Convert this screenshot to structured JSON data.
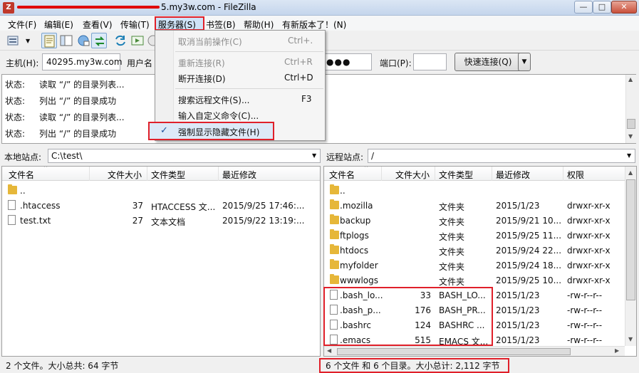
{
  "window": {
    "title": "5.my3w.com - FileZilla",
    "min": "—",
    "max": "□",
    "close": "✕"
  },
  "menubar": [
    "文件(F)",
    "编辑(E)",
    "查看(V)",
    "传输(T)",
    "服务器(S)",
    "书签(B)",
    "帮助(H)",
    "有新版本了！(N)"
  ],
  "quickconnect": {
    "host_label": "主机(H):",
    "host_value": "40295.my3w.com",
    "user_label": "用户名",
    "pass_value": "●●●",
    "port_label": "端口(P):",
    "port_value": "",
    "connect_button": "快速连接(Q)"
  },
  "server_menu": {
    "cancel": "取消当前操作(C)",
    "cancel_sc": "Ctrl+.",
    "reconnect": "重新连接(R)",
    "reconnect_sc": "Ctrl+R",
    "disconnect": "断开连接(D)",
    "disconnect_sc": "Ctrl+D",
    "search": "搜索远程文件(S)...",
    "search_sc": "F3",
    "custom_cmd": "输入自定义命令(C)...",
    "check": "✓",
    "force_hidden": "强制显示隐藏文件(H)"
  },
  "log": [
    {
      "k": "状态:",
      "v": "读取 “/” 的目录列表..."
    },
    {
      "k": "状态:",
      "v": "列出 “/” 的目录成功"
    },
    {
      "k": "状态:",
      "v": "读取 “/” 的目录列表..."
    },
    {
      "k": "状态:",
      "v": "列出 “/” 的目录成功"
    }
  ],
  "local": {
    "site_label": "本地站点:",
    "path": "C:\\test\\",
    "columns": [
      "文件名",
      "文件大小",
      "文件类型",
      "最近修改"
    ],
    "rows": [
      {
        "icon": "folder",
        "name": "..",
        "size": "",
        "type": "",
        "mod": ""
      },
      {
        "icon": "file",
        "name": ".htaccess",
        "size": "37",
        "type": "HTACCESS 文...",
        "mod": "2015/9/25 17:46:..."
      },
      {
        "icon": "file",
        "name": "test.txt",
        "size": "27",
        "type": "文本文档",
        "mod": "2015/9/22 13:19:..."
      }
    ],
    "status": "2 个文件。大小总共: 64 字节"
  },
  "remote": {
    "site_label": "远程站点:",
    "path": "/",
    "columns": [
      "文件名",
      "文件大小",
      "文件类型",
      "最近修改",
      "权限"
    ],
    "rows": [
      {
        "icon": "folder",
        "name": "..",
        "size": "",
        "type": "",
        "mod": "",
        "perm": ""
      },
      {
        "icon": "folder",
        "name": ".mozilla",
        "size": "",
        "type": "文件夹",
        "mod": "2015/1/23",
        "perm": "drwxr-xr-x"
      },
      {
        "icon": "folder",
        "name": "backup",
        "size": "",
        "type": "文件夹",
        "mod": "2015/9/21 10...",
        "perm": "drwxr-xr-x"
      },
      {
        "icon": "folder",
        "name": "ftplogs",
        "size": "",
        "type": "文件夹",
        "mod": "2015/9/25 11...",
        "perm": "drwxr-xr-x"
      },
      {
        "icon": "folder",
        "name": "htdocs",
        "size": "",
        "type": "文件夹",
        "mod": "2015/9/24 22...",
        "perm": "drwxr-xr-x"
      },
      {
        "icon": "folder",
        "name": "myfolder",
        "size": "",
        "type": "文件夹",
        "mod": "2015/9/24 18...",
        "perm": "drwxr-xr-x"
      },
      {
        "icon": "folder",
        "name": "wwwlogs",
        "size": "",
        "type": "文件夹",
        "mod": "2015/9/25 10...",
        "perm": "drwxr-xr-x"
      },
      {
        "icon": "file",
        "name": ".bash_lo...",
        "size": "33",
        "type": "BASH_LO...",
        "mod": "2015/1/23",
        "perm": "-rw-r--r--"
      },
      {
        "icon": "file",
        "name": ".bash_p...",
        "size": "176",
        "type": "BASH_PR...",
        "mod": "2015/1/23",
        "perm": "-rw-r--r--"
      },
      {
        "icon": "file",
        "name": ".bashrc",
        "size": "124",
        "type": "BASHRC ...",
        "mod": "2015/1/23",
        "perm": "-rw-r--r--"
      },
      {
        "icon": "file",
        "name": ".emacs",
        "size": "515",
        "type": "EMACS 文...",
        "mod": "2015/1/23",
        "perm": "-rw-r--r--"
      }
    ],
    "status": "6 个文件 和 6 个目录。大小总计: 2,112 字节"
  },
  "colors": {
    "highlight": "#e0202a",
    "folder": "#e6b739"
  }
}
